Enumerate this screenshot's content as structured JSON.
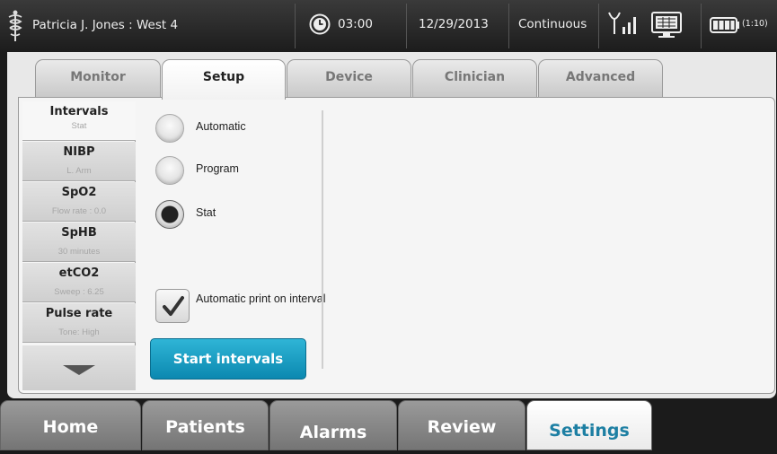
{
  "header": {
    "patient": "Patricia J. Jones : West 4",
    "clock_time": "03:00",
    "date": "12/29/2013",
    "mode": "Continuous",
    "battery_time": "(1:10)"
  },
  "tabs": [
    {
      "label": "Monitor"
    },
    {
      "label": "Setup"
    },
    {
      "label": "Device"
    },
    {
      "label": "Clinician"
    },
    {
      "label": "Advanced"
    }
  ],
  "leftnav": [
    {
      "title": "Intervals",
      "sub": "Stat"
    },
    {
      "title": "NIBP",
      "sub": "L. Arm"
    },
    {
      "title": "SpO2",
      "sub": "Flow rate : 0.0"
    },
    {
      "title": "SpHB",
      "sub": "30 minutes"
    },
    {
      "title": "etCO2",
      "sub": "Sweep : 6.25"
    },
    {
      "title": "Pulse rate",
      "sub": "Tone: High"
    }
  ],
  "options": {
    "radios": [
      {
        "label": "Automatic",
        "selected": false
      },
      {
        "label": "Program",
        "selected": false
      },
      {
        "label": "Stat",
        "selected": true
      }
    ],
    "checkbox_label": "Automatic print on interval",
    "checkbox_checked": true,
    "start_button": "Start intervals"
  },
  "bottomnav": [
    {
      "label": "Home"
    },
    {
      "label": "Patients"
    },
    {
      "label": "Alarms"
    },
    {
      "label": "Review"
    },
    {
      "label": "Settings"
    }
  ],
  "colors": {
    "accent": "#1d7fa3",
    "button": "#0b88b0"
  }
}
